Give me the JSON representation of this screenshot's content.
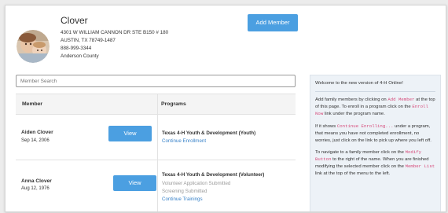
{
  "family": {
    "name": "Clover",
    "address1": "4301 W WILLIAM CANNON DR STE B150 # 180",
    "address2": "AUSTIN, TX 78749-1487",
    "phone": "888-999-3344",
    "county": "Anderson County"
  },
  "add_member_label": "Add Member",
  "search": {
    "placeholder": "Member Search",
    "value": ""
  },
  "table": {
    "headers": {
      "member": "Member",
      "programs": "Programs"
    },
    "rows": [
      {
        "name": "Aiden Clover",
        "date": "Sep 14, 2006",
        "view_label": "View",
        "program": "Texas 4-H Youth & Development (Youth)",
        "lines": [
          {
            "text": "Continue Enrollment",
            "kind": "link"
          }
        ]
      },
      {
        "name": "Anna Clover",
        "date": "Aug 12, 1976",
        "view_label": "View",
        "program": "Texas 4-H Youth & Development (Volunteer)",
        "lines": [
          {
            "text": "Volunteer Application Submitted",
            "kind": "muted"
          },
          {
            "text": "Screening Submitted",
            "kind": "muted"
          },
          {
            "text": "Continue Trainings",
            "kind": "link"
          }
        ]
      }
    ]
  },
  "info": {
    "welcome": "Welcome to the new version of 4-H Online!",
    "p1": {
      "t1": "Add family members by clicking on ",
      "c1": "Add Member",
      "t2": " at the top of this page. To enroll in a program click on the ",
      "c2": "Enroll Now",
      "t3": " link under the program name."
    },
    "p2": {
      "t1": "If it shows ",
      "c1": "Continue Enrolling...",
      "t2": " under a program, that means you have not completed enrollment, no worries, just click on the link to pick up where you left off."
    },
    "p3": {
      "t1": "To navigate to a family member click on the ",
      "c1": "Modify Button",
      "t2": " to the right of the name. When you are finished modifying the selected member click on the ",
      "c2": "Member List",
      "t3": " link at the top of the menu to the left."
    }
  },
  "colors": {
    "accent": "#4b9fe1",
    "link": "#3a83c9",
    "code": "#d64a7a",
    "info_bg": "#edf2f7"
  }
}
